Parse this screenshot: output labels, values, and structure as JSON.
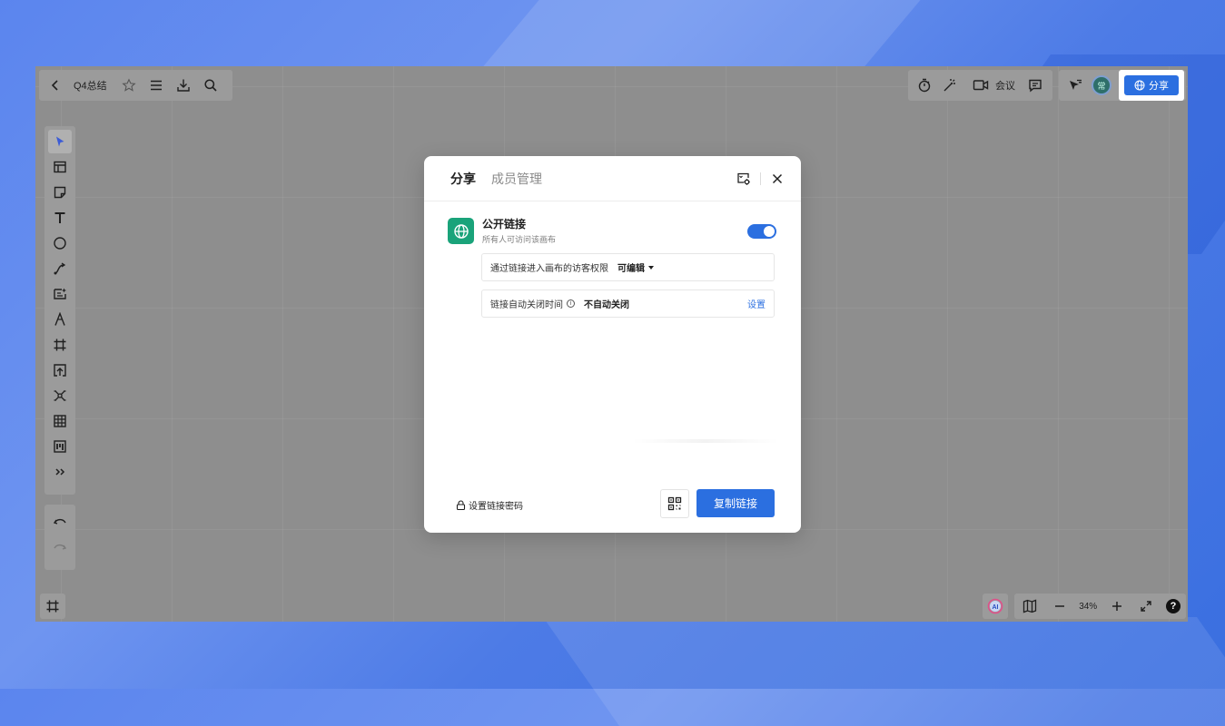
{
  "toolbar": {
    "doc_title": "Q4总结",
    "meeting_label": "会议",
    "share_label": "分享",
    "avatar_text": "常"
  },
  "canvas": {
    "zoom_label": "34%",
    "help_label": "?"
  },
  "dialog": {
    "tabs": [
      {
        "label": "分享",
        "active": true
      },
      {
        "label": "成员管理",
        "active": false
      }
    ],
    "public_link": {
      "title": "公开链接",
      "subtitle": "所有人可访问该画布",
      "enabled": true
    },
    "guest_permission": {
      "label": "通过链接进入画布的访客权限",
      "value": "可编辑"
    },
    "auto_close": {
      "label": "链接自动关闭时间",
      "value": "不自动关闭",
      "action": "设置"
    },
    "password_label": "设置链接密码",
    "copy_label": "复制链接"
  },
  "colors": {
    "accent": "#2b6fe0",
    "badge_green": "#1aa37a",
    "canvas_gray": "#8e8e8e"
  }
}
